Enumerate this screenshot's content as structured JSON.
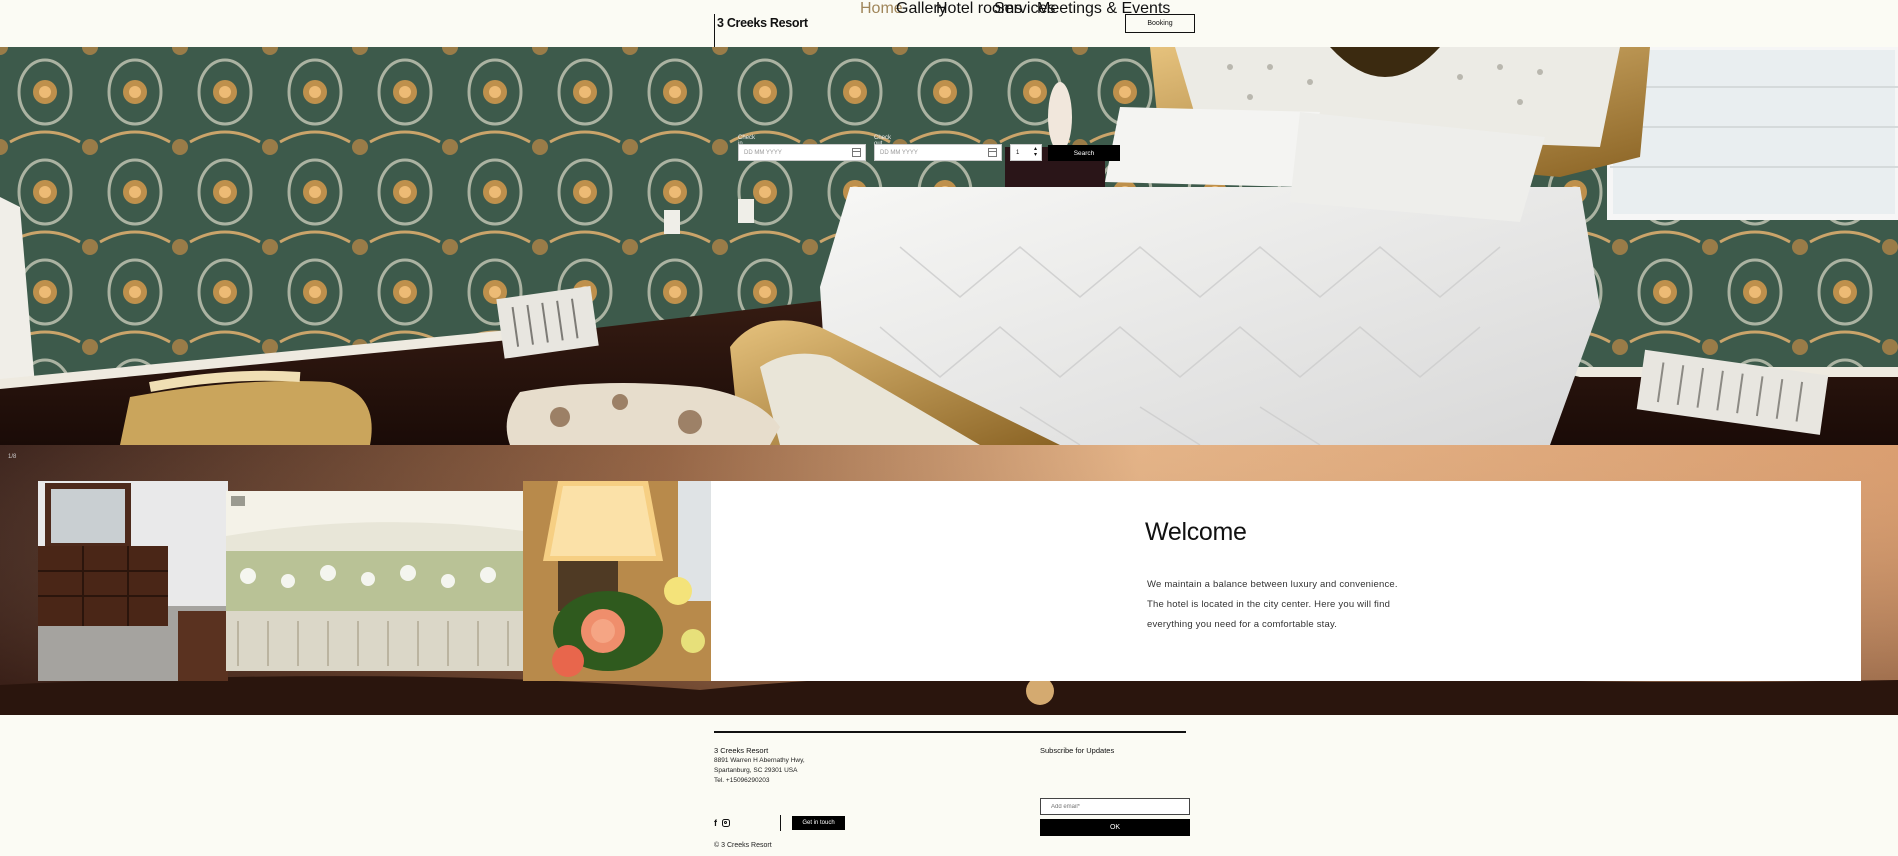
{
  "header": {
    "logo": "3 Creeks Resort",
    "nav": [
      {
        "label": "Home",
        "active": true
      },
      {
        "label": "Gallery",
        "active": false
      },
      {
        "label": "Hotel rooms",
        "active": false
      },
      {
        "label": "Services",
        "active": false
      },
      {
        "label": "Meetings & Events",
        "active": false
      }
    ],
    "booking_label": "Booking"
  },
  "booking_form": {
    "checkin_label": "Check in",
    "checkin_placeholder": "DD MM YYYY",
    "checkout_label": "Check out",
    "checkout_placeholder": "DD MM YYYY",
    "guests_value": "1",
    "search_label": "Search"
  },
  "strip": {
    "counter": "1/8"
  },
  "welcome": {
    "title": "Welcome",
    "line1": "We maintain a balance between luxury and convenience.",
    "line2": "The hotel is located in the city center. Here you will find",
    "line3": "everything you need for a comfortable stay."
  },
  "footer": {
    "name": "3 Creeks Resort",
    "address1": "8891 Warren H Abernathy Hwy,",
    "address2": "Spartanburg, SC 29301 USA",
    "tel": "Tel. +15096290203",
    "get_in_touch": "Get in touch",
    "copyright": "© 3 Creeks Resort",
    "subscribe_title": "Subscribe for Updates",
    "email_placeholder": "Add email*",
    "ok_label": "OK"
  },
  "icons": [
    "facebook-icon",
    "instagram-icon",
    "calendar-icon",
    "stepper-icon"
  ],
  "colors": {
    "background": "#fbfbf4",
    "nav_active": "#a0865a",
    "button": "#000000"
  }
}
